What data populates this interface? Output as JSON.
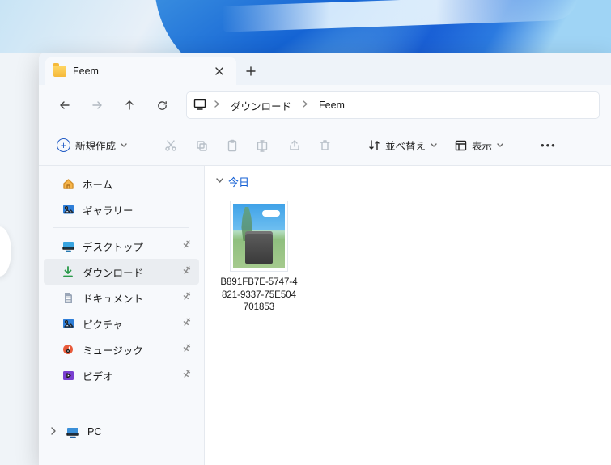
{
  "tab": {
    "title": "Feem"
  },
  "breadcrumb": {
    "seg1": "ダウンロード",
    "seg2": "Feem"
  },
  "cmd": {
    "new": "新規作成",
    "sort": "並べ替え",
    "view": "表示"
  },
  "sidebar": {
    "home": "ホーム",
    "gallery": "ギャラリー",
    "desktop": "デスクトップ",
    "downloads": "ダウンロード",
    "documents": "ドキュメント",
    "pictures": "ピクチャ",
    "music": "ミュージック",
    "videos": "ビデオ",
    "pc": "PC"
  },
  "content": {
    "group_today": "今日",
    "files": [
      {
        "name_l1": "B891FB7E-5747-4",
        "name_l2": "821-9337-75E504",
        "name_l3": "701853"
      }
    ]
  }
}
